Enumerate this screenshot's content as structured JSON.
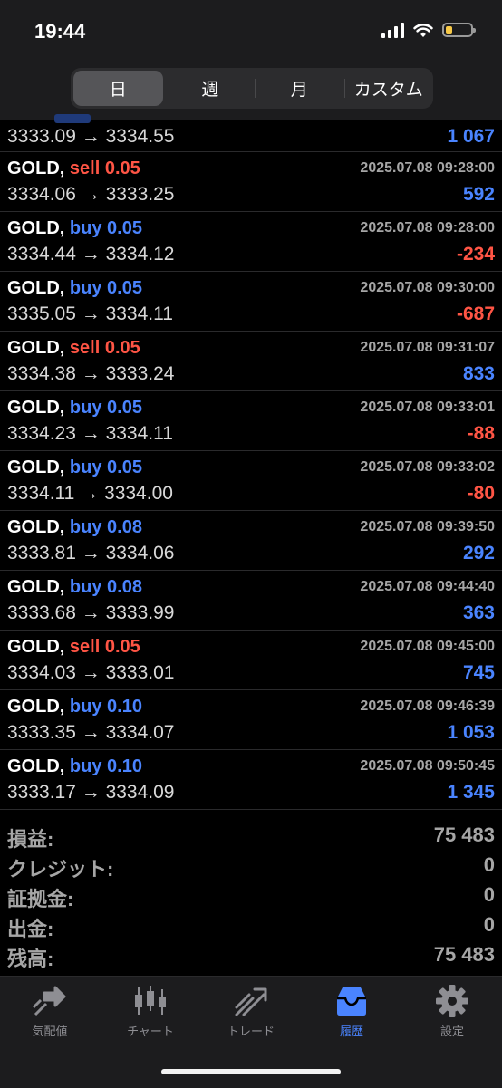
{
  "status": {
    "time": "19:44"
  },
  "tabs_period": [
    "日",
    "週",
    "月",
    "カスタム"
  ],
  "partial_row": {
    "prices": "3333.09 → 3334.55",
    "profit": "1 067"
  },
  "trades": [
    {
      "symbol": "GOLD,",
      "side": "sell",
      "volume_text": "sell 0.05",
      "datetime": "2025.07.08 09:28:00",
      "prices": "3334.06 → 3333.25",
      "profit": "592",
      "profit_sign": "pos"
    },
    {
      "symbol": "GOLD,",
      "side": "buy",
      "volume_text": "buy 0.05",
      "datetime": "2025.07.08 09:28:00",
      "prices": "3334.44 → 3334.12",
      "profit": "-234",
      "profit_sign": "neg"
    },
    {
      "symbol": "GOLD,",
      "side": "buy",
      "volume_text": "buy 0.05",
      "datetime": "2025.07.08 09:30:00",
      "prices": "3335.05 → 3334.11",
      "profit": "-687",
      "profit_sign": "neg"
    },
    {
      "symbol": "GOLD,",
      "side": "sell",
      "volume_text": "sell 0.05",
      "datetime": "2025.07.08 09:31:07",
      "prices": "3334.38 → 3333.24",
      "profit": "833",
      "profit_sign": "pos"
    },
    {
      "symbol": "GOLD,",
      "side": "buy",
      "volume_text": "buy 0.05",
      "datetime": "2025.07.08 09:33:01",
      "prices": "3334.23 → 3334.11",
      "profit": "-88",
      "profit_sign": "neg"
    },
    {
      "symbol": "GOLD,",
      "side": "buy",
      "volume_text": "buy 0.05",
      "datetime": "2025.07.08 09:33:02",
      "prices": "3334.11 → 3334.00",
      "profit": "-80",
      "profit_sign": "neg"
    },
    {
      "symbol": "GOLD,",
      "side": "buy",
      "volume_text": "buy 0.08",
      "datetime": "2025.07.08 09:39:50",
      "prices": "3333.81 → 3334.06",
      "profit": "292",
      "profit_sign": "pos"
    },
    {
      "symbol": "GOLD,",
      "side": "buy",
      "volume_text": "buy 0.08",
      "datetime": "2025.07.08 09:44:40",
      "prices": "3333.68 → 3333.99",
      "profit": "363",
      "profit_sign": "pos"
    },
    {
      "symbol": "GOLD,",
      "side": "sell",
      "volume_text": "sell 0.05",
      "datetime": "2025.07.08 09:45:00",
      "prices": "3334.03 → 3333.01",
      "profit": "745",
      "profit_sign": "pos"
    },
    {
      "symbol": "GOLD,",
      "side": "buy",
      "volume_text": "buy 0.10",
      "datetime": "2025.07.08 09:46:39",
      "prices": "3333.35 → 3334.07",
      "profit": "1 053",
      "profit_sign": "pos"
    },
    {
      "symbol": "GOLD,",
      "side": "buy",
      "volume_text": "buy 0.10",
      "datetime": "2025.07.08 09:50:45",
      "prices": "3333.17 → 3334.09",
      "profit": "1 345",
      "profit_sign": "pos"
    }
  ],
  "summary": [
    {
      "label": "損益:",
      "value": "75 483"
    },
    {
      "label": "クレジット:",
      "value": "0"
    },
    {
      "label": "証拠金:",
      "value": "0"
    },
    {
      "label": "出金:",
      "value": "0"
    },
    {
      "label": "残高:",
      "value": "75 483"
    }
  ],
  "tabbar": [
    {
      "label": "気配値",
      "icon": "quotes-icon"
    },
    {
      "label": "チャート",
      "icon": "chart-icon"
    },
    {
      "label": "トレード",
      "icon": "trade-icon"
    },
    {
      "label": "履歴",
      "icon": "history-icon"
    },
    {
      "label": "設定",
      "icon": "settings-icon"
    }
  ],
  "colors": {
    "buy": "#4a84ff",
    "sell": "#ff5545",
    "background": "#000000",
    "bar": "#1c1c1e"
  }
}
